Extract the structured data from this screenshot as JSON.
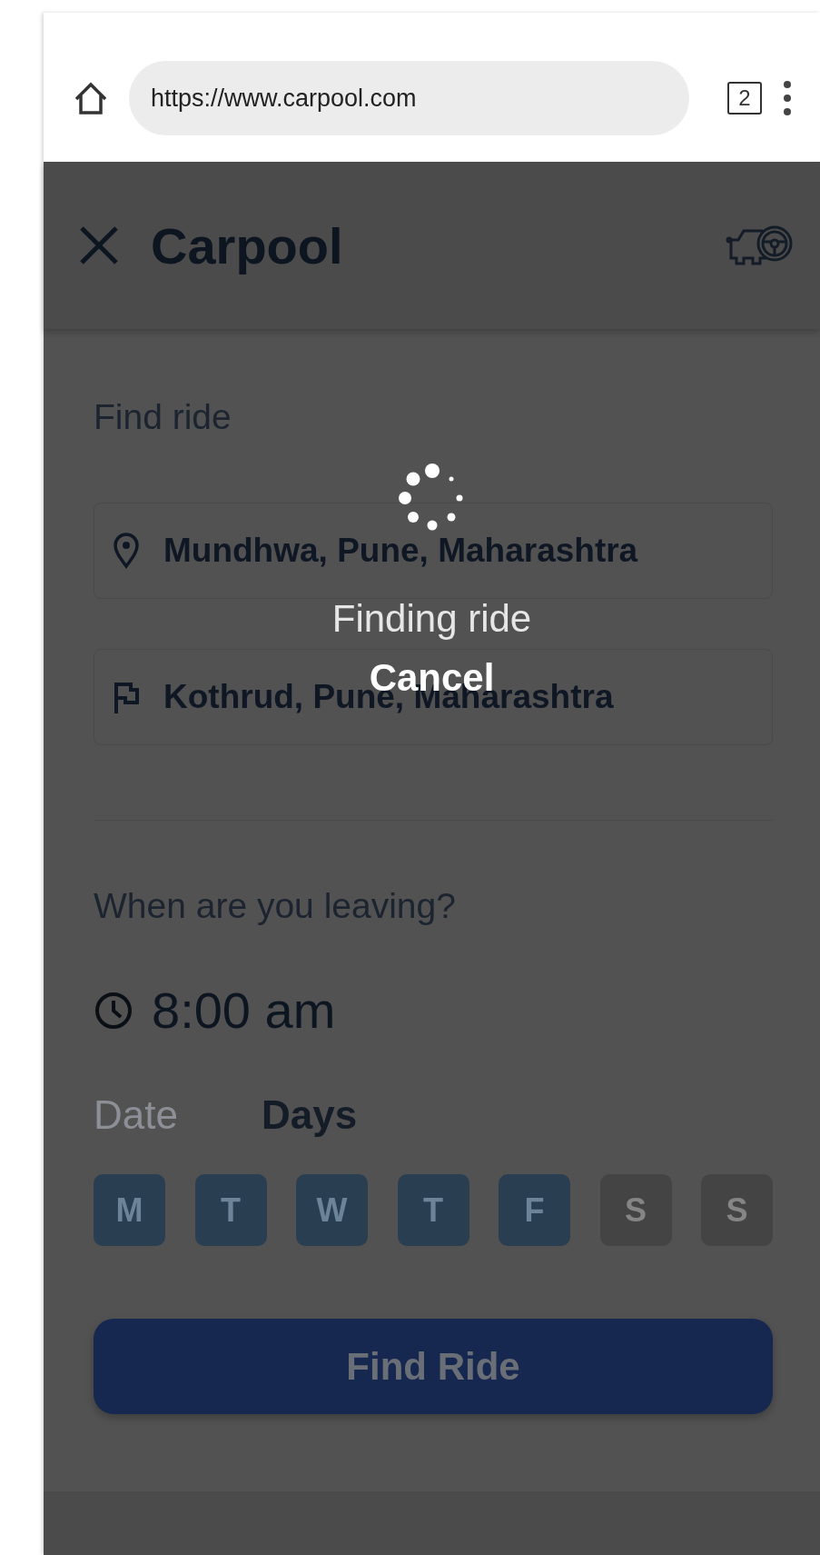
{
  "browser": {
    "url": "https://www.carpool.com",
    "tab_count": "2"
  },
  "app": {
    "title": "Carpool"
  },
  "find_ride": {
    "heading": "Find ride",
    "origin": "Mundhwa, Pune, Maharashtra",
    "destination": "Kothrud, Pune, Maharashtra"
  },
  "schedule": {
    "heading": "When are you leaving?",
    "time": "8:00 am",
    "modes": [
      {
        "label": "Date",
        "selected": false
      },
      {
        "label": "Days",
        "selected": true
      }
    ],
    "days": [
      {
        "label": "M",
        "selected": true
      },
      {
        "label": "T",
        "selected": true
      },
      {
        "label": "W",
        "selected": true
      },
      {
        "label": "T",
        "selected": true
      },
      {
        "label": "F",
        "selected": true
      },
      {
        "label": "S",
        "selected": false
      },
      {
        "label": "S",
        "selected": false
      }
    ]
  },
  "submit": "Find Ride",
  "loading": {
    "message": "Finding ride",
    "cancel": "Cancel"
  }
}
